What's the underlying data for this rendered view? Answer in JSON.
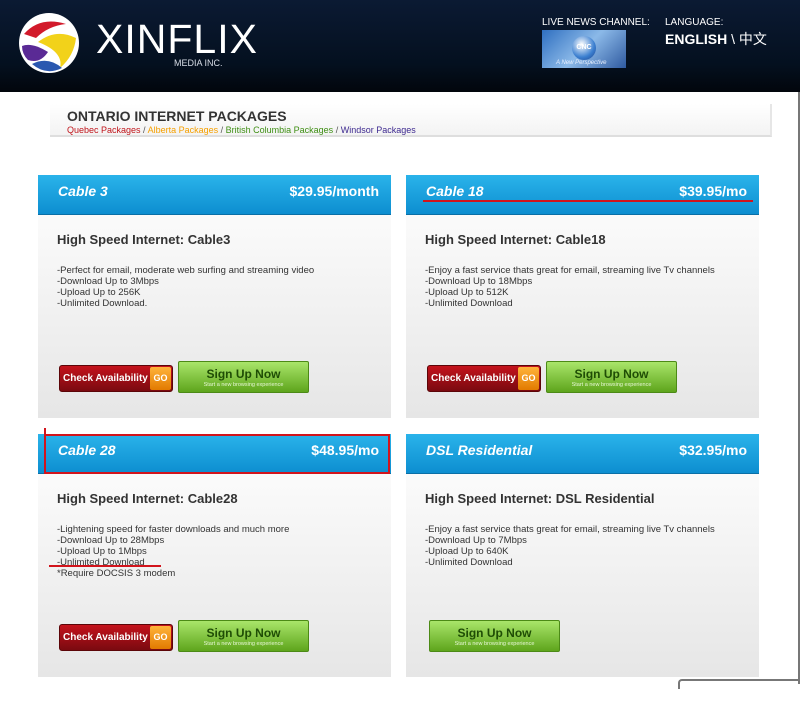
{
  "header": {
    "brand": "XINFLIX",
    "brand_sub": "MEDIA INC.",
    "news_label": "LIVE NEWS CHANNEL:",
    "news_logo": "CNC",
    "news_tag": "A New Perspective",
    "language_label": "LANGUAGE:",
    "language_english": "ENGLISH",
    "language_sep": " \\ ",
    "language_chinese": "中文"
  },
  "title": {
    "heading": "ONTARIO INTERNET PACKAGES",
    "links": [
      {
        "label": "Quebec Packages",
        "color": "#c0151b"
      },
      {
        "label": "Alberta Packages",
        "color": "#f5a000"
      },
      {
        "label": "British Columbia Packages",
        "color": "#3f8f14"
      },
      {
        "label": "Windsor Packages",
        "color": "#3e2a90"
      }
    ],
    "sep": " / "
  },
  "buttons": {
    "check_label": "Check Availability",
    "check_go": "GO",
    "signup_label": "Sign Up Now",
    "signup_sub": "Start a new browsing experience"
  },
  "cards": [
    {
      "name": "Cable 3",
      "price": "$29.95/month",
      "heading": "High Speed Internet: Cable3",
      "features": [
        "-Perfect for email, moderate web surfing and streaming video",
        "-Download Up to 3Mbps",
        "-Upload Up to 256K",
        "-Unlimited Download."
      ]
    },
    {
      "name": "Cable 18",
      "price": "$39.95/mo",
      "heading": "High Speed Internet: Cable18",
      "features": [
        "-Enjoy a fast service thats great for email, streaming live Tv channels",
        "-Download Up to 18Mbps",
        "-Upload Up to 512K",
        "-Unlimited Download"
      ]
    },
    {
      "name": "Cable 28",
      "price": "$48.95/mo",
      "heading": "High Speed Internet: Cable28",
      "features": [
        "-Lightening speed for faster downloads and much more",
        "-Download Up to 28Mbps",
        "-Upload Up to 1Mbps",
        "-Unlimited Download",
        "*Require DOCSIS 3 modem"
      ]
    },
    {
      "name": "DSL Residential",
      "price": "$32.95/mo",
      "heading": "High Speed Internet: DSL Residential",
      "features": [
        "-Enjoy a fast service thats great for email, streaming live Tv channels",
        "-Download Up to 7Mbps",
        "-Upload Up to 640K",
        "-Unlimited Download"
      ]
    }
  ],
  "colors": {
    "header_bg": "#04101f",
    "card_header": "#1aa2df",
    "check_button": "#a8101a",
    "signup_button": "#7cc534",
    "annotation_red": "#d2141c"
  }
}
